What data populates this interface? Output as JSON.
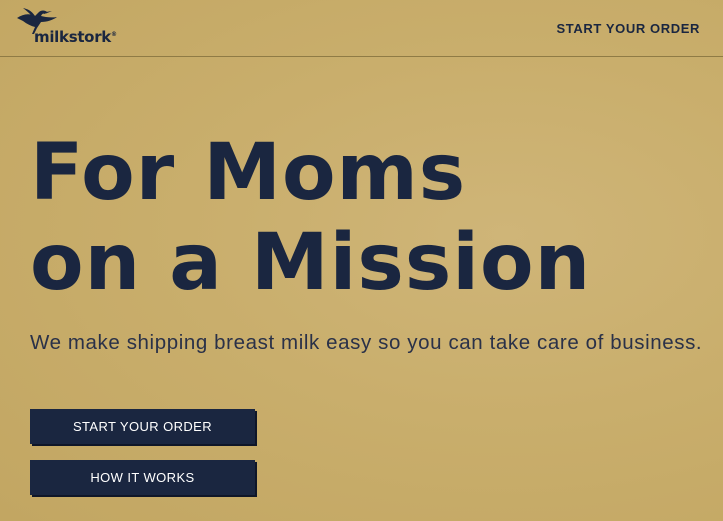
{
  "header": {
    "logo": {
      "text": "milkstork",
      "trademark": "®",
      "icon": "stork-icon"
    },
    "nav_cta_label": "START YOUR ORDER"
  },
  "hero": {
    "title_line1": "For Moms",
    "title_line2": "on a Mission",
    "subtitle": "We make shipping breast milk easy so you can take care of business."
  },
  "buttons": {
    "start_order_label": "START YOUR ORDER",
    "how_it_works_label": "HOW IT WORKS"
  },
  "colors": {
    "background": "#c8ad6a",
    "navy": "#1a2640",
    "button_text": "#ffffff"
  }
}
